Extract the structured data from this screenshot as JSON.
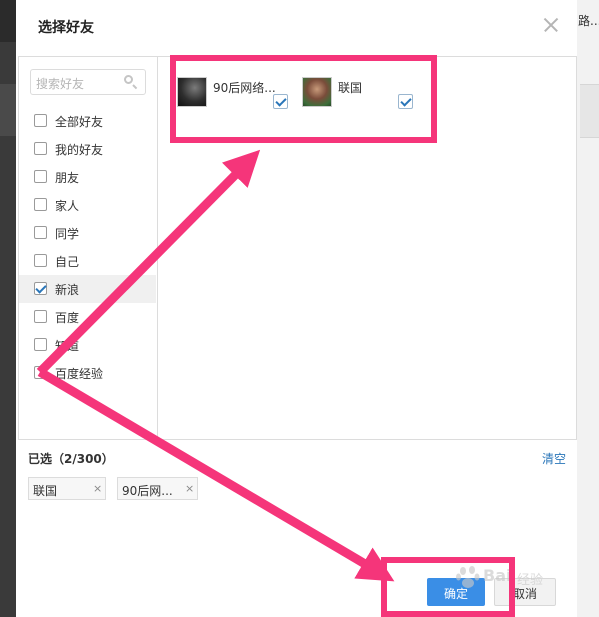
{
  "background": {
    "right_text": "路..."
  },
  "dialog": {
    "title": "选择好友",
    "close_icon": "close-icon",
    "search": {
      "placeholder": "搜索好友",
      "icon": "search-icon"
    },
    "groups": [
      {
        "label": "全部好友",
        "checked": false
      },
      {
        "label": "我的好友",
        "checked": false
      },
      {
        "label": "朋友",
        "checked": false
      },
      {
        "label": "家人",
        "checked": false
      },
      {
        "label": "同学",
        "checked": false
      },
      {
        "label": "自己",
        "checked": false
      },
      {
        "label": "新浪",
        "checked": true,
        "selected": true
      },
      {
        "label": "百度",
        "checked": false
      },
      {
        "label": "知道",
        "checked": false
      },
      {
        "label": "百度经验",
        "checked": false
      }
    ],
    "friends": [
      {
        "name": "90后网络...",
        "checked": true,
        "avatar": "dark-portrait-avatar"
      },
      {
        "name": "联国",
        "checked": true,
        "avatar": "child-portrait-avatar"
      }
    ],
    "selected_summary": "已选（2/300）",
    "clear_label": "清空",
    "selected_tags": [
      {
        "label": "联国",
        "remove": "×"
      },
      {
        "label": "90后网...",
        "remove": "×"
      }
    ],
    "ok_label": "确定",
    "cancel_label": "取消"
  },
  "watermark": {
    "brand": "Bai",
    "suffix": "经验"
  },
  "colors": {
    "annotation": "#f5357a",
    "primary_button": "#3a8ee6",
    "link": "#2a76b9",
    "check": "#2a76b9"
  }
}
